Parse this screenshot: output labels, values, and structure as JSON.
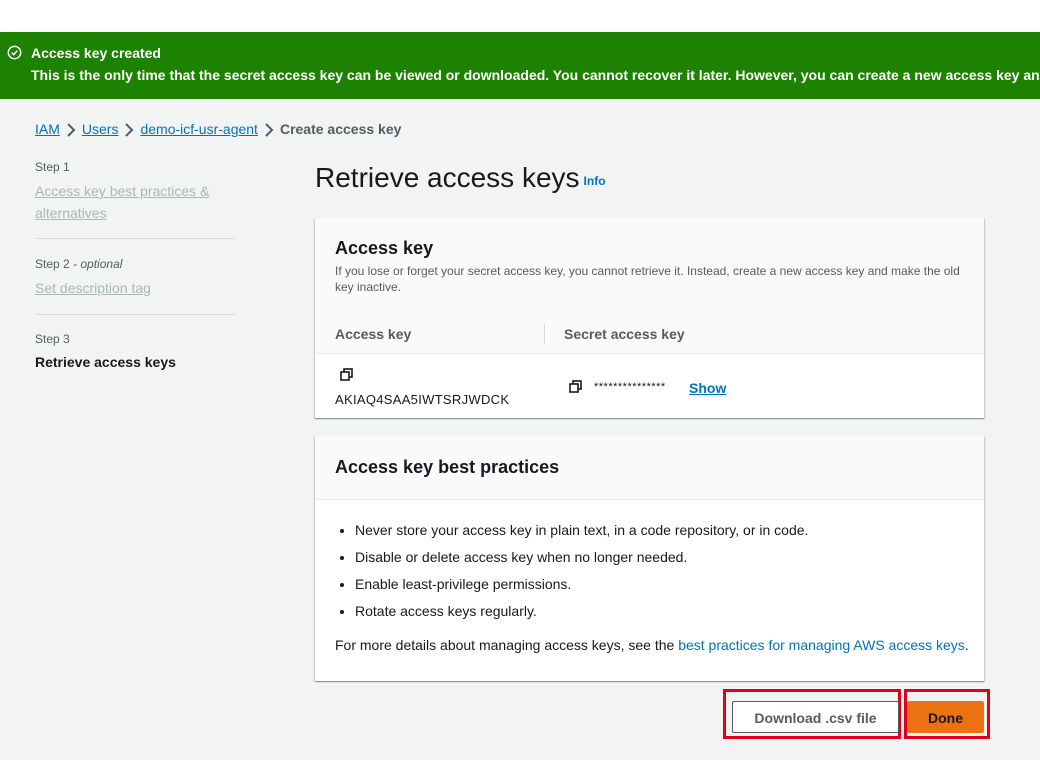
{
  "flash": {
    "title": "Access key created",
    "message": "This is the only time that the secret access key can be viewed or downloaded. You cannot recover it later. However, you can create a new access key any time.",
    "icon": "check-circle-icon",
    "color": "#1d8102"
  },
  "breadcrumb": {
    "items": [
      "IAM",
      "Users",
      "demo-icf-usr-agent"
    ],
    "current": "Create access key"
  },
  "steps": [
    {
      "step": "Step 1",
      "label": "Access key best practices & alternatives"
    },
    {
      "step": "Step 2",
      "optional": "- optional",
      "label": "Set description tag"
    },
    {
      "step": "Step 3",
      "label": "Retrieve access keys"
    }
  ],
  "page": {
    "title": "Retrieve access keys",
    "info": "Info"
  },
  "access_key_card": {
    "title": "Access key",
    "description": "If you lose or forget your secret access key, you cannot retrieve it. Instead, create a new access key and make the old key inactive.",
    "col_access_key": "Access key",
    "col_secret": "Secret access key",
    "access_key_value": "AKIAQ4SAA5IWTSRJWDCK",
    "secret_masked": "***************",
    "show_label": "Show"
  },
  "best_practices_card": {
    "title": "Access key best practices",
    "items": [
      "Never store your access key in plain text, in a code repository, or in code.",
      "Disable or delete access key when no longer needed.",
      "Enable least-privilege permissions.",
      "Rotate access keys regularly."
    ],
    "more_prefix": "For more details about managing access keys, see the ",
    "more_link": "best practices for managing AWS access keys",
    "more_suffix": "."
  },
  "actions": {
    "download_label": "Download .csv file",
    "done_label": "Done",
    "accent": "#ec7211"
  }
}
